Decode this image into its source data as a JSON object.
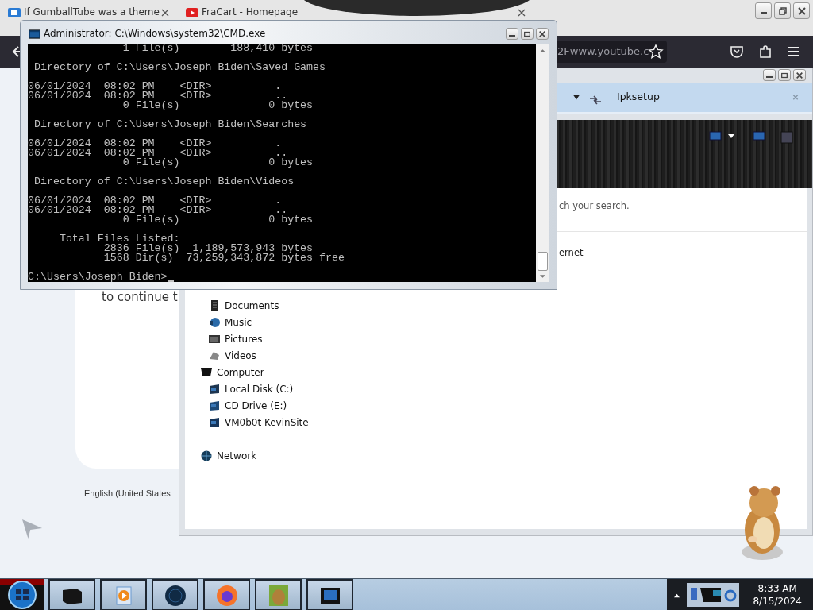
{
  "browser": {
    "tabs": [
      {
        "title": "If GumballTube was a theme"
      },
      {
        "title": "FraCart - Homepage"
      }
    ],
    "address": "2Fwww.youtube.c",
    "page": {
      "prompt_text": "to continue t",
      "language": "English (United States"
    }
  },
  "explorer": {
    "address": "Ipksetup",
    "search_message": "ch your search.",
    "link_text": "ernet",
    "libraries": [
      "Documents",
      "Music",
      "Pictures",
      "Videos"
    ],
    "tree": [
      {
        "label": "Computer",
        "children": [
          {
            "label": "Local Disk (C:)"
          },
          {
            "label": "CD Drive (E:)"
          },
          {
            "label": "VM0b0t KevinSite"
          }
        ]
      },
      {
        "label": "Network"
      }
    ]
  },
  "console": {
    "title": "Administrator: C:\\Windows\\system32\\CMD.exe",
    "blocks": [
      [
        "               1 File(s)        188,410 bytes"
      ],
      [
        " Directory of C:\\Users\\Joseph Biden\\Saved Games"
      ],
      [
        "06/01/2024  08:02 PM    <DIR>          .",
        "06/01/2024  08:02 PM    <DIR>          ..",
        "               0 File(s)              0 bytes"
      ],
      [
        " Directory of C:\\Users\\Joseph Biden\\Searches"
      ],
      [
        "06/01/2024  08:02 PM    <DIR>          .",
        "06/01/2024  08:02 PM    <DIR>          ..",
        "               0 File(s)              0 bytes"
      ],
      [
        " Directory of C:\\Users\\Joseph Biden\\Videos"
      ],
      [
        "06/01/2024  08:02 PM    <DIR>          .",
        "06/01/2024  08:02 PM    <DIR>          ..",
        "               0 File(s)              0 bytes"
      ],
      [
        "     Total Files Listed:",
        "            2836 File(s)  1,189,573,943 bytes",
        "            1568 Dir(s)  73,259,343,872 bytes free"
      ],
      [
        "C:\\Users\\Joseph Biden>"
      ]
    ]
  },
  "taskbar": {
    "clock_time": "8:33 AM",
    "clock_date": "8/15/2024"
  }
}
